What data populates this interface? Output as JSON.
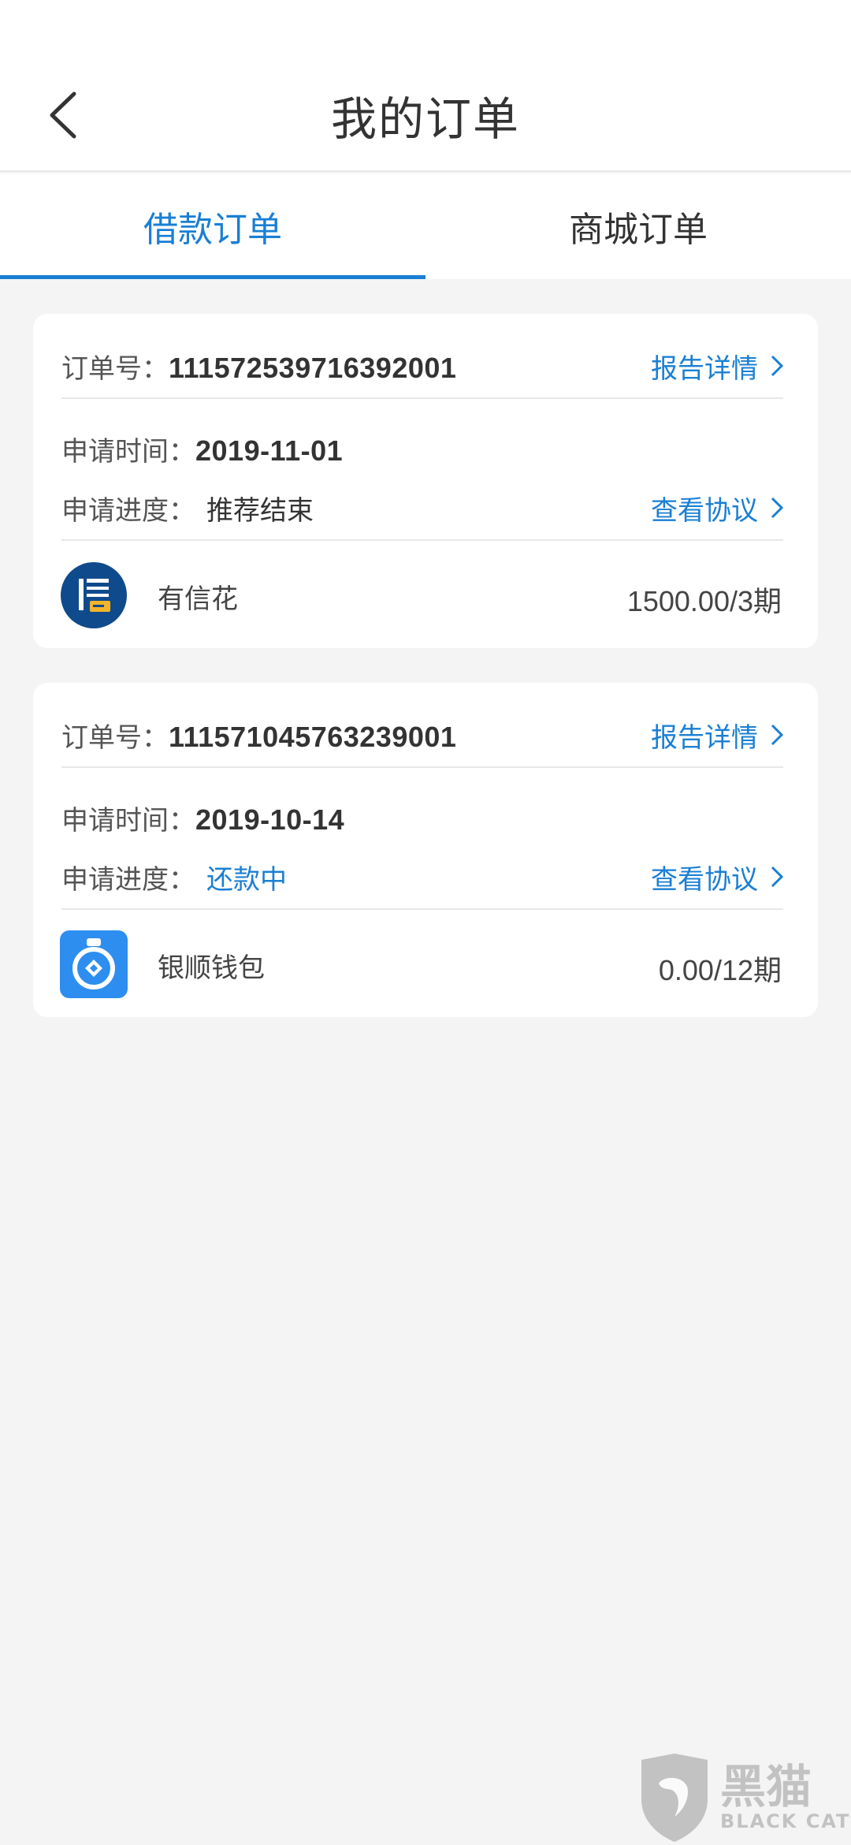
{
  "header": {
    "title": "我的订单"
  },
  "tabs": [
    {
      "label": "借款订单",
      "active": true
    },
    {
      "label": "商城订单",
      "active": false
    }
  ],
  "orders": [
    {
      "order_label": "订单号：",
      "order_no": "111572539716392001",
      "report_link": "报告详情",
      "time_label": "申请时间：",
      "time": "2019-11-01",
      "progress_label": "申请进度：",
      "progress": "推荐结束",
      "agreement_link": "查看协议",
      "product": "有信花",
      "amount": "1500.00/3期",
      "logo_icon": "xin-logo-icon"
    },
    {
      "order_label": "订单号：",
      "order_no": "111571045763239001",
      "report_link": "报告详情",
      "time_label": "申请时间：",
      "time": "2019-10-14",
      "progress_label": "申请进度：",
      "progress": "还款中",
      "agreement_link": "查看协议",
      "product": "银顺钱包",
      "amount": "0.00/12期",
      "logo_icon": "wallet-logo-icon"
    }
  ],
  "watermark": {
    "cn": "黑猫",
    "en": "BLACK CAT"
  },
  "colors": {
    "accent": "#1a7fd4",
    "background": "#f4f4f4"
  }
}
